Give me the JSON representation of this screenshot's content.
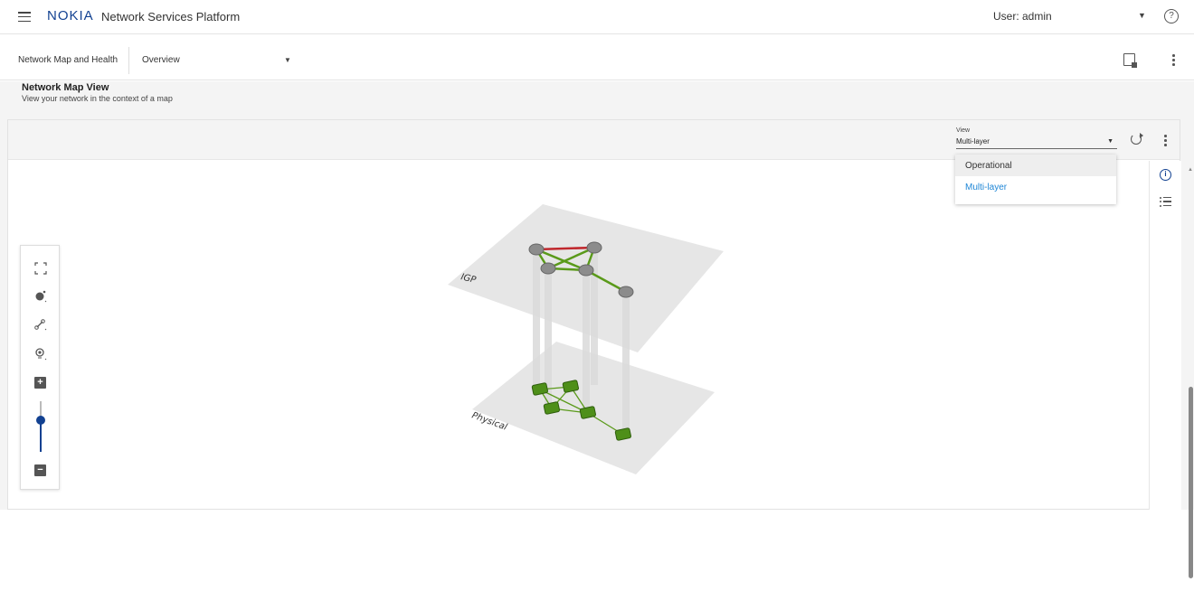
{
  "header": {
    "logo": "NOKIA",
    "app_title": "Network Services Platform",
    "user_label": "User: admin"
  },
  "subheader": {
    "breadcrumb": "Network Map and Health",
    "view_selector": "Overview"
  },
  "page": {
    "title": "Network Map View",
    "subtitle": "View your network in the context of a map"
  },
  "toolbar": {
    "view_label": "View",
    "view_value": "Multi-layer",
    "view_options": [
      "Operational",
      "Multi-layer"
    ]
  },
  "map": {
    "layer_top_label": "IGP",
    "layer_bottom_label": "Physical",
    "colors": {
      "plane": "#e6e6e6",
      "link_up": "#5a9a1a",
      "link_down": "#c0282d",
      "router": "#8c8c8c",
      "switch": "#4e8f19",
      "accent": "#124191",
      "selected": "#1f86d6"
    }
  },
  "icons": {
    "menu": "hamburger-icon",
    "help": "help-icon",
    "report": "report-icon",
    "more": "kebab-icon",
    "refresh": "refresh-icon",
    "info": "info-icon",
    "list": "list-icon",
    "fit": "fit-screen-icon",
    "node": "node-tool-icon",
    "link": "link-tool-icon",
    "location": "location-tool-icon",
    "zoom_in": "zoom-in-icon",
    "zoom_out": "zoom-out-icon"
  }
}
